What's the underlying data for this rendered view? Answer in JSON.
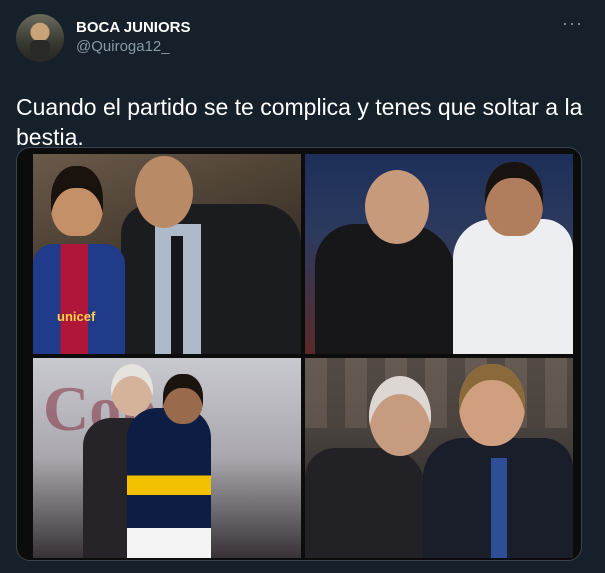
{
  "tweet": {
    "display_name": "BOCA JUNIORS",
    "handle": "@Quiroga12_",
    "more_menu": "···",
    "text": "Cuando el partido se te complica y tenes que soltar a la bestia."
  },
  "media": {
    "photo_texts": {
      "jersey_sponsor": "unicef",
      "banner": "Copa"
    }
  },
  "colors": {
    "background": "#15202b",
    "secondary_text": "#8899a6"
  }
}
